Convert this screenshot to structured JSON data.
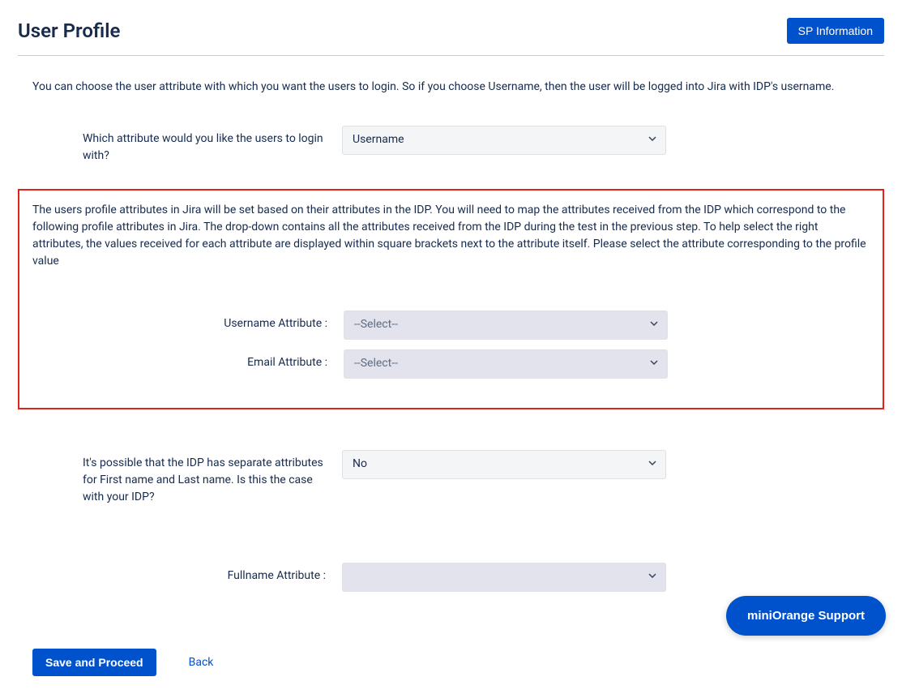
{
  "header": {
    "title": "User Profile",
    "sp_info_label": "SP Information"
  },
  "intro": "You can choose the user attribute with which you want the users to login. So if you choose Username, then the user will be logged into Jira with IDP's username.",
  "login_attr": {
    "label": "Which attribute would you like the users to login with?",
    "value": "Username"
  },
  "highlight": {
    "text": "The users profile attributes in Jira will be set based on their attributes in the IDP. You will need to map the attributes received from the IDP which correspond to the following profile attributes in Jira. The drop-down contains all the attributes received from the IDP during the test in the previous step. To help select the right attributes, the values received for each attribute are displayed within square brackets next to the attribute itself. Please select the attribute corresponding to the profile value",
    "username_attr_label": "Username Attribute :",
    "username_attr_value": "--Select--",
    "email_attr_label": "Email Attribute :",
    "email_attr_value": "--Select--"
  },
  "separate_names": {
    "label": "It's possible that the IDP has separate attributes for First name and Last name. Is this the case with your IDP?",
    "value": "No"
  },
  "fullname": {
    "label": "Fullname Attribute :",
    "value": ""
  },
  "actions": {
    "save_label": "Save and Proceed",
    "back_label": "Back"
  },
  "support_label": "miniOrange Support"
}
